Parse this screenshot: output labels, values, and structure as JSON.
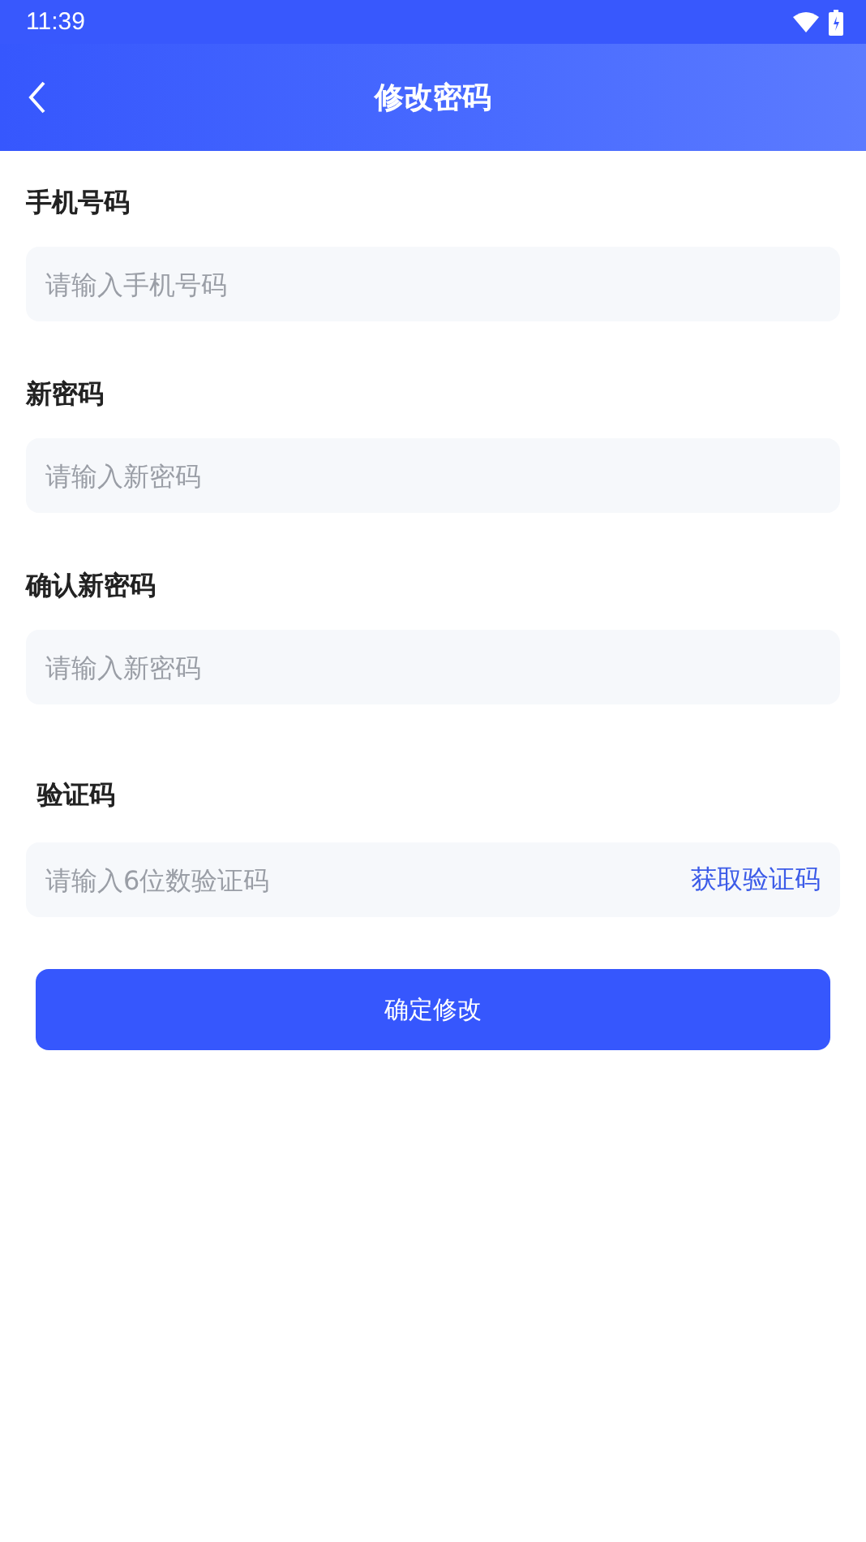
{
  "status_bar": {
    "time": "11:39"
  },
  "header": {
    "title": "修改密码"
  },
  "fields": [
    {
      "kind": "text",
      "label": "手机号码",
      "placeholder": "请输入手机号码"
    },
    {
      "kind": "text",
      "label": "新密码",
      "placeholder": "请输入新密码"
    },
    {
      "kind": "text",
      "label": "确认新密码",
      "placeholder": "请输入新密码"
    },
    {
      "kind": "code",
      "label": "验证码",
      "placeholder": "请输入6位数验证码",
      "action": "获取验证码"
    }
  ],
  "submit_button": "确定修改"
}
